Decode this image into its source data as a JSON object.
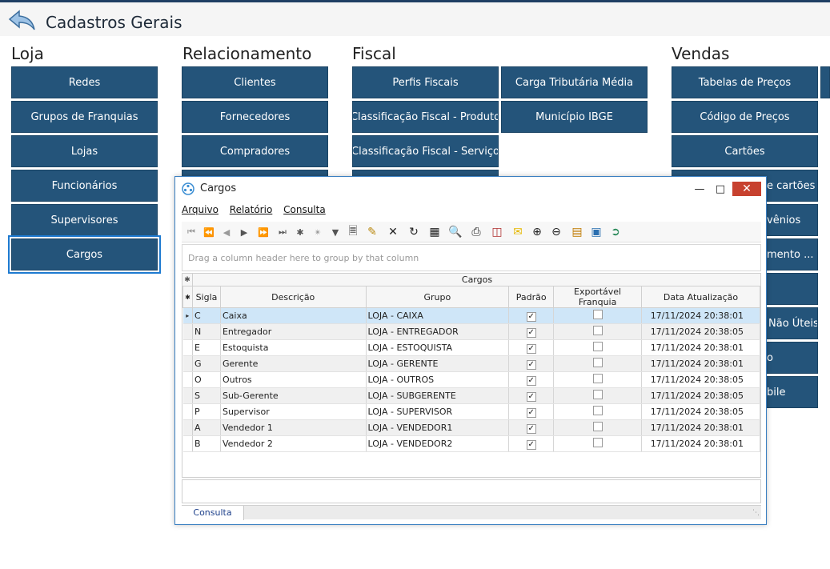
{
  "header": {
    "title": "Cadastros Gerais",
    "back_icon": "back-arrow-icon"
  },
  "sections": {
    "loja": {
      "title": "Loja",
      "items": [
        "Redes",
        "Grupos de Franquias",
        "Lojas",
        "Funcionários",
        "Supervisores",
        "Cargos"
      ]
    },
    "relacionamento": {
      "title": "Relacionamento",
      "items": [
        "Clientes",
        "Fornecedores",
        "Compradores"
      ]
    },
    "fiscal": {
      "title": "Fiscal",
      "col1": [
        "Perfis Fiscais",
        "Classificação Fiscal - Produto",
        "Classificação Fiscal - Serviço"
      ],
      "col2": [
        "Carga Tributária Média",
        "Município IBGE"
      ]
    },
    "vendas": {
      "title": "Vendas",
      "items": [
        "Tabelas de Preços",
        "Código de Preços",
        "Cartões"
      ],
      "partial": [
        "e cartões",
        "vênios",
        "mento ...",
        "",
        "Não Úteis",
        "o",
        "bile"
      ]
    }
  },
  "dialog": {
    "title": "Cargos",
    "menu": [
      "Arquivo",
      "Relatório",
      "Consulta"
    ],
    "toolbar_icons": [
      "first-record-icon",
      "prev-page-icon",
      "prev-record-icon",
      "next-record-icon",
      "next-page-icon",
      "last-record-icon",
      "insert-record-icon",
      "append-record-icon",
      "filter-icon",
      "new-document-icon",
      "edit-document-icon",
      "delete-icon",
      "refresh-icon",
      "properties-icon",
      "preview-icon",
      "print-icon",
      "export-icon",
      "email-icon",
      "zoom-in-icon",
      "zoom-out-icon",
      "columns-icon",
      "layout-icon",
      "exit-icon"
    ],
    "group_panel_text": "Drag a column header here to group by that column",
    "grid": {
      "band_title": "Cargos",
      "columns": [
        "Sigla",
        "Descrição",
        "Grupo",
        "Padrão",
        "Exportável Franquia",
        "Data Atualização"
      ],
      "rows": [
        {
          "sigla": "C",
          "descricao": "Caixa",
          "grupo": "LOJA - CAIXA",
          "padrao": true,
          "exportavel": false,
          "data": "17/11/2024 20:38:01"
        },
        {
          "sigla": "N",
          "descricao": "Entregador",
          "grupo": "LOJA - ENTREGADOR",
          "padrao": true,
          "exportavel": false,
          "data": "17/11/2024 20:38:05"
        },
        {
          "sigla": "E",
          "descricao": "Estoquista",
          "grupo": "LOJA - ESTOQUISTA",
          "padrao": true,
          "exportavel": false,
          "data": "17/11/2024 20:38:01"
        },
        {
          "sigla": "G",
          "descricao": "Gerente",
          "grupo": "LOJA - GERENTE",
          "padrao": true,
          "exportavel": false,
          "data": "17/11/2024 20:38:01"
        },
        {
          "sigla": "O",
          "descricao": "Outros",
          "grupo": "LOJA - OUTROS",
          "padrao": true,
          "exportavel": false,
          "data": "17/11/2024 20:38:05"
        },
        {
          "sigla": "S",
          "descricao": "Sub-Gerente",
          "grupo": "LOJA - SUBGERENTE",
          "padrao": true,
          "exportavel": false,
          "data": "17/11/2024 20:38:05"
        },
        {
          "sigla": "P",
          "descricao": "Supervisor",
          "grupo": "LOJA - SUPERVISOR",
          "padrao": true,
          "exportavel": false,
          "data": "17/11/2024 20:38:05"
        },
        {
          "sigla": "A",
          "descricao": "Vendedor 1",
          "grupo": "LOJA - VENDEDOR1",
          "padrao": true,
          "exportavel": false,
          "data": "17/11/2024 20:38:01"
        },
        {
          "sigla": "B",
          "descricao": "Vendedor 2",
          "grupo": "LOJA - VENDEDOR2",
          "padrao": true,
          "exportavel": false,
          "data": "17/11/2024 20:38:01"
        }
      ]
    },
    "tab": "Consulta"
  }
}
